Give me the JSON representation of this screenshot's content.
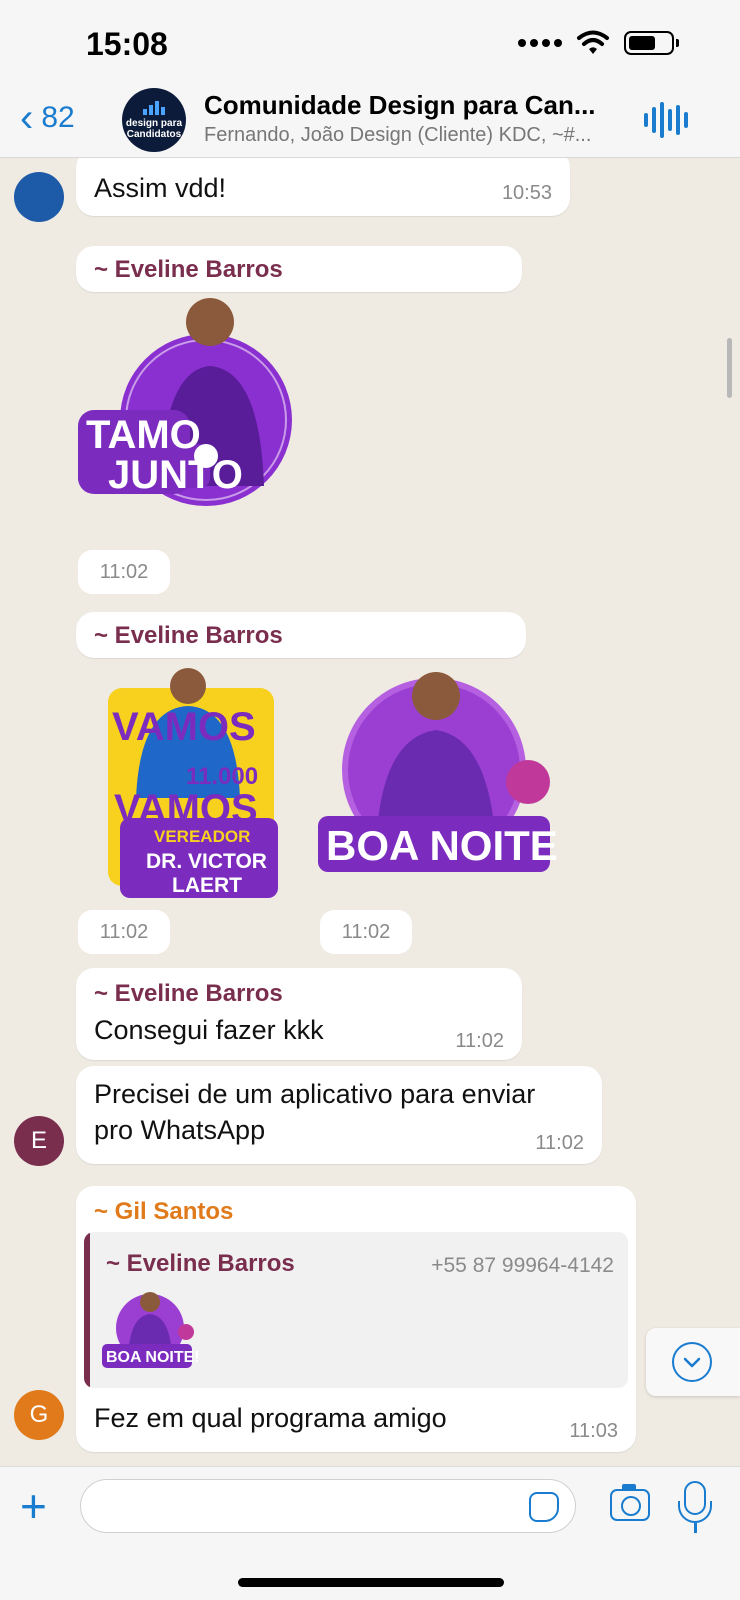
{
  "status_bar": {
    "time": "15:08"
  },
  "header": {
    "back_count": "82",
    "group_name": "Comunidade Design para Can...",
    "members": "Fernando, João Design (Cliente) KDC, ~#...",
    "avatar_text": "design para Candidatos"
  },
  "messages": [
    {
      "text": "Assim vdd!",
      "time": "10:53"
    },
    {
      "sender": "~ Eveline Barros",
      "sticker_text": [
        "TAMO",
        "JUNTO"
      ],
      "time": "11:02"
    },
    {
      "sender": "~ Eveline Barros",
      "sticker1_text": [
        "VAMOS",
        "11.000",
        "VAMOS",
        "VEREADOR",
        "DR. VICTOR",
        "LAERT"
      ],
      "sticker2_text": "BOA NOITE!",
      "time1": "11:02",
      "time2": "11:02"
    },
    {
      "sender": "~ Eveline Barros",
      "text": "Consegui fazer kkk",
      "time": "11:02"
    },
    {
      "avatar_letter": "E",
      "text_line1": "Precisei de um aplicativo para enviar",
      "text_line2": "pro WhatsApp",
      "time": "11:02"
    },
    {
      "sender": "~ Gil Santos",
      "avatar_letter": "G",
      "quote_sender": "~ Eveline Barros",
      "quote_phone": "+55 87 99964-4142",
      "quote_sticker": "BOA NOITE!",
      "text": "Fez em qual programa amigo",
      "time": "11:03"
    }
  ],
  "colors": {
    "accent": "#1a7ccf",
    "sender_eveline": "#7a2e4e",
    "sender_gil": "#e07a1a",
    "sticker_purple": "#7b2cbf"
  }
}
